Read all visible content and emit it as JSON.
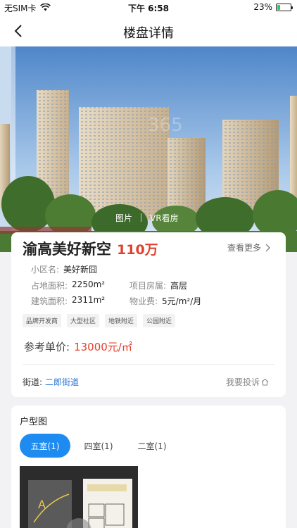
{
  "status_bar": {
    "carrier": "无SIM卡",
    "time": "下午 6:58",
    "battery": "23%",
    "battery_level": 0.23
  },
  "nav": {
    "title": "楼盘详情"
  },
  "media_tabs": [
    "图片",
    "VR看房"
  ],
  "property": {
    "name": "渝高美好新空",
    "price": "110万",
    "more_label": "查看更多",
    "fields": {
      "community": {
        "label": "小区名:",
        "value": "美好新囧"
      },
      "land_area": {
        "label": "占地面积:",
        "value": "2250m²"
      },
      "building_type": {
        "label": "项目房属:",
        "value": "高层"
      },
      "build_area": {
        "label": "建筑面积:",
        "value": "2311m²"
      },
      "property_fee": {
        "label": "物业费:",
        "value": "5元/m²/月"
      }
    },
    "tags": [
      "品牌开发商",
      "大型社区",
      "地铁附近",
      "公园附近"
    ],
    "unit_price": {
      "label": "参考单价:",
      "value": "13000元/㎡"
    },
    "street": {
      "label": "街道:",
      "value": "二郎街道"
    },
    "complain_label": "我要投诉"
  },
  "floor_plan": {
    "title": "户型图",
    "tabs": [
      {
        "label": "五室(1)",
        "active": true
      },
      {
        "label": "四室(1)",
        "active": false
      },
      {
        "label": "二室(1)",
        "active": false
      }
    ]
  },
  "colors": {
    "accent": "#1e8bf0",
    "price": "#e2402e",
    "link": "#2a74d6"
  }
}
